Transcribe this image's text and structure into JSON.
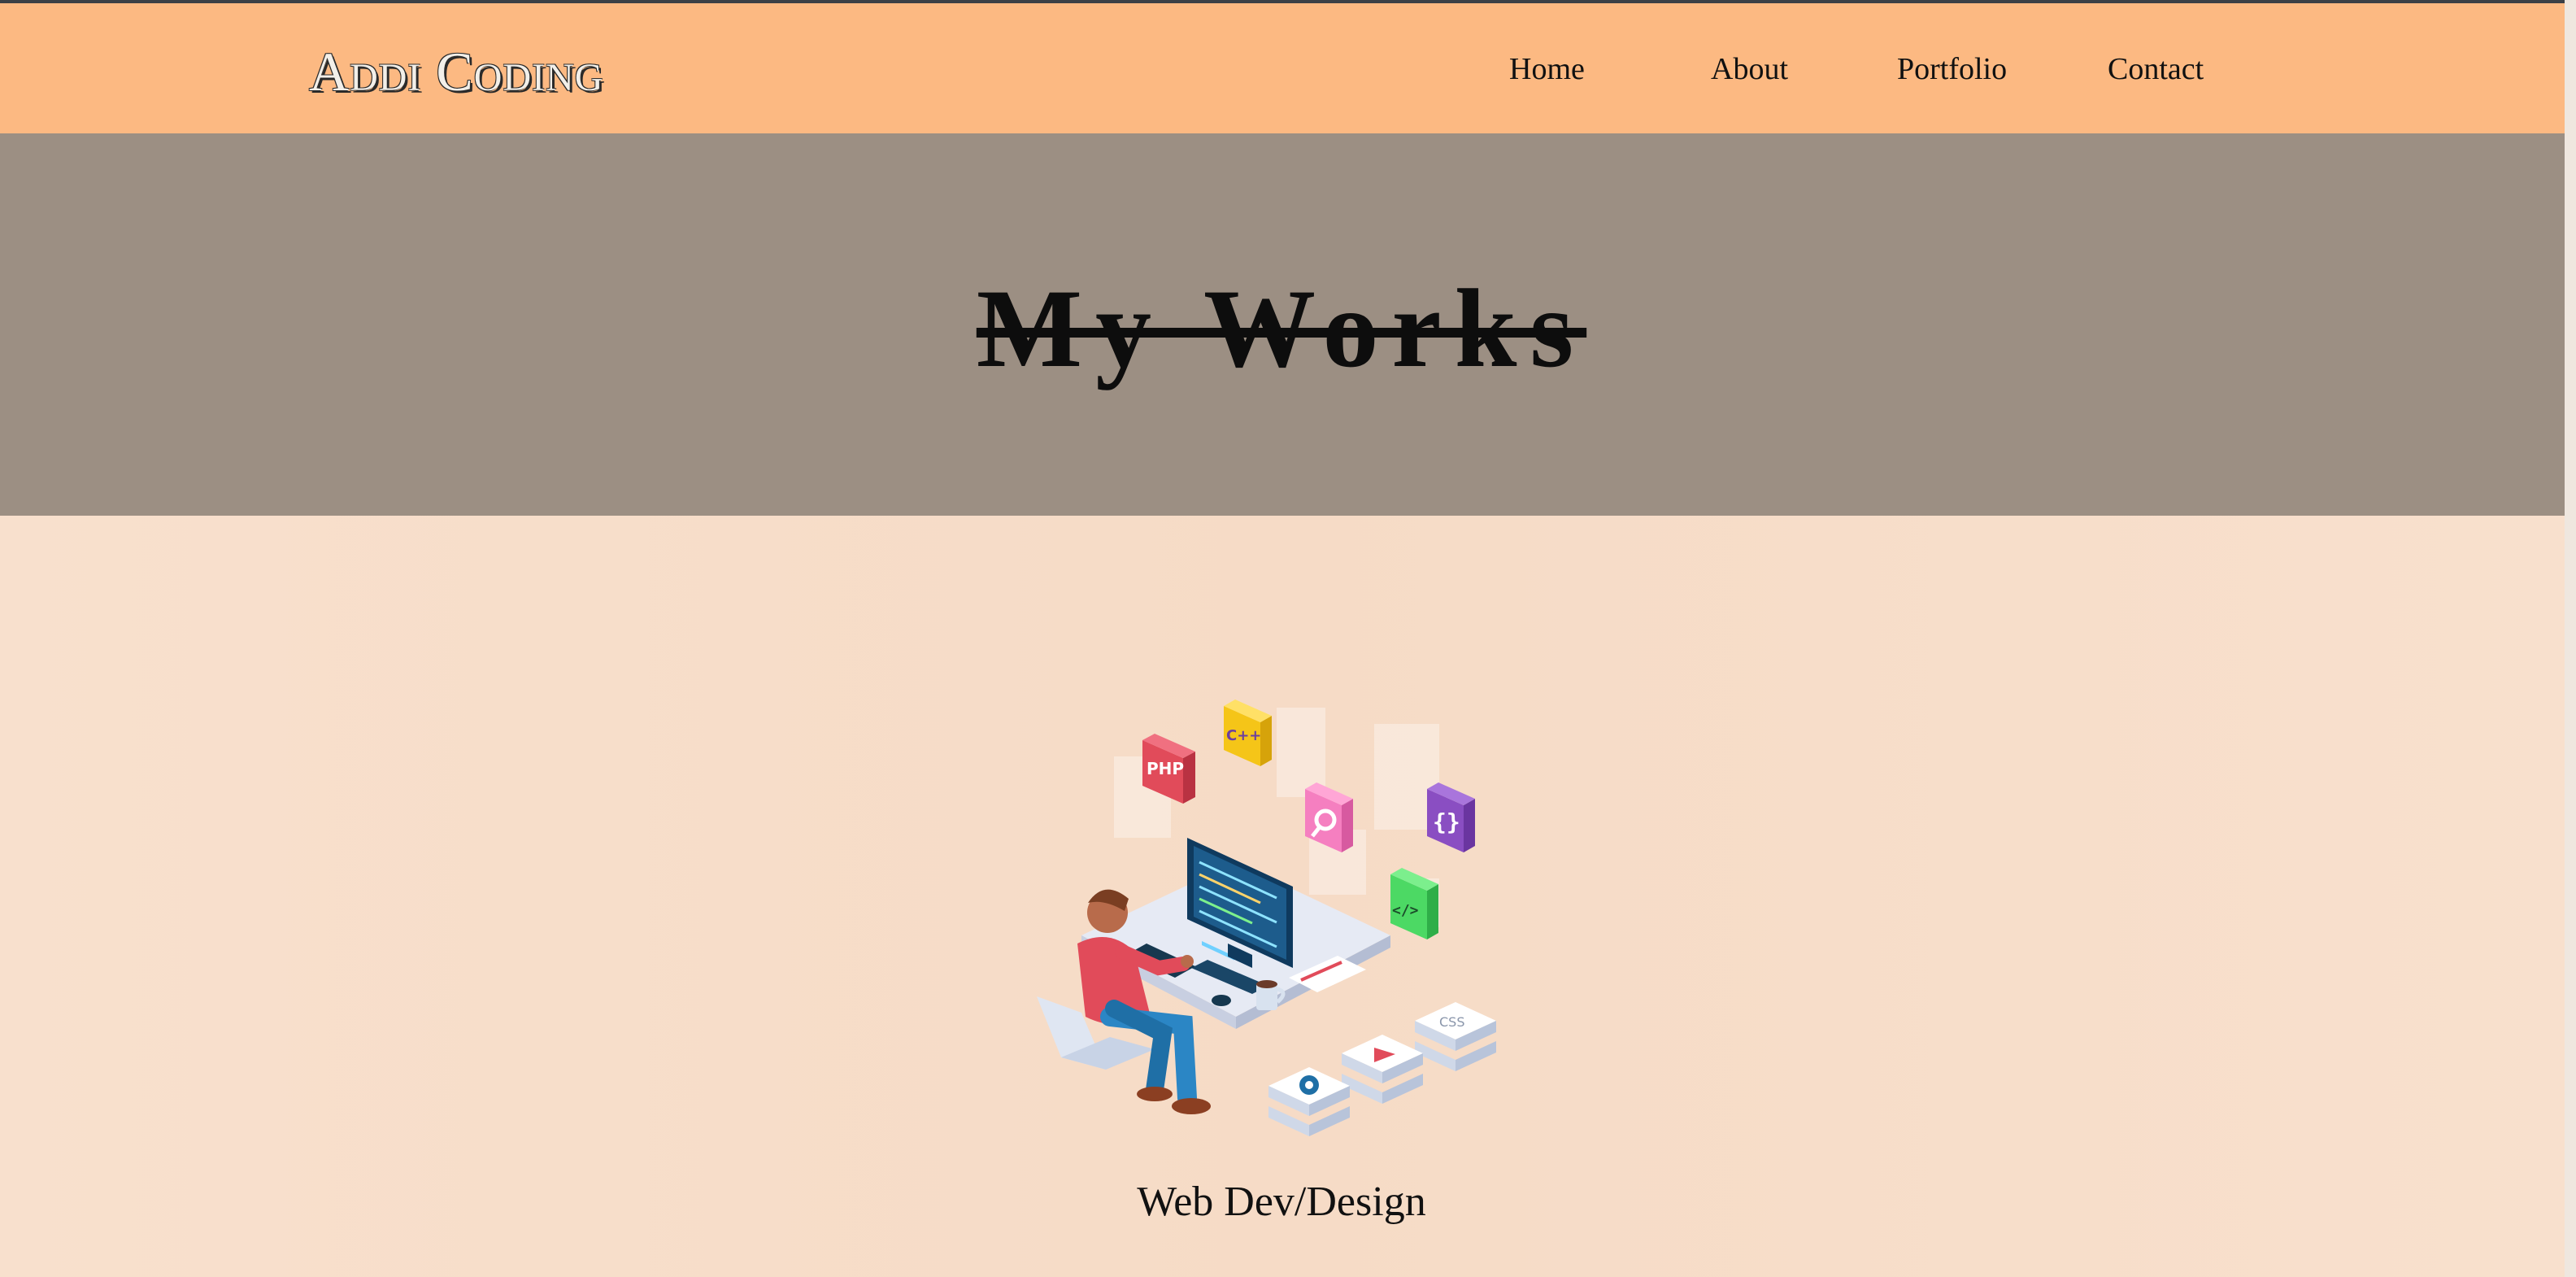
{
  "header": {
    "brand": "Addi Coding",
    "nav": [
      {
        "label": "Home"
      },
      {
        "label": "About"
      },
      {
        "label": "Portfolio"
      },
      {
        "label": "Contact"
      }
    ]
  },
  "hero": {
    "title": "My Works"
  },
  "portfolio": {
    "items": [
      {
        "title": "Web Dev/Design",
        "image_icons": [
          "developer-at-computer",
          "php-block-icon",
          "cpp-block-icon",
          "search-block-icon",
          "braces-block-icon",
          "code-tag-block-icon",
          "css-stack-icon",
          "play-stack-icon",
          "gear-stack-icon"
        ]
      }
    ]
  },
  "colors": {
    "navbar": "#fcb982",
    "hero": "#9c8f83",
    "content": "#f6dcc6"
  }
}
